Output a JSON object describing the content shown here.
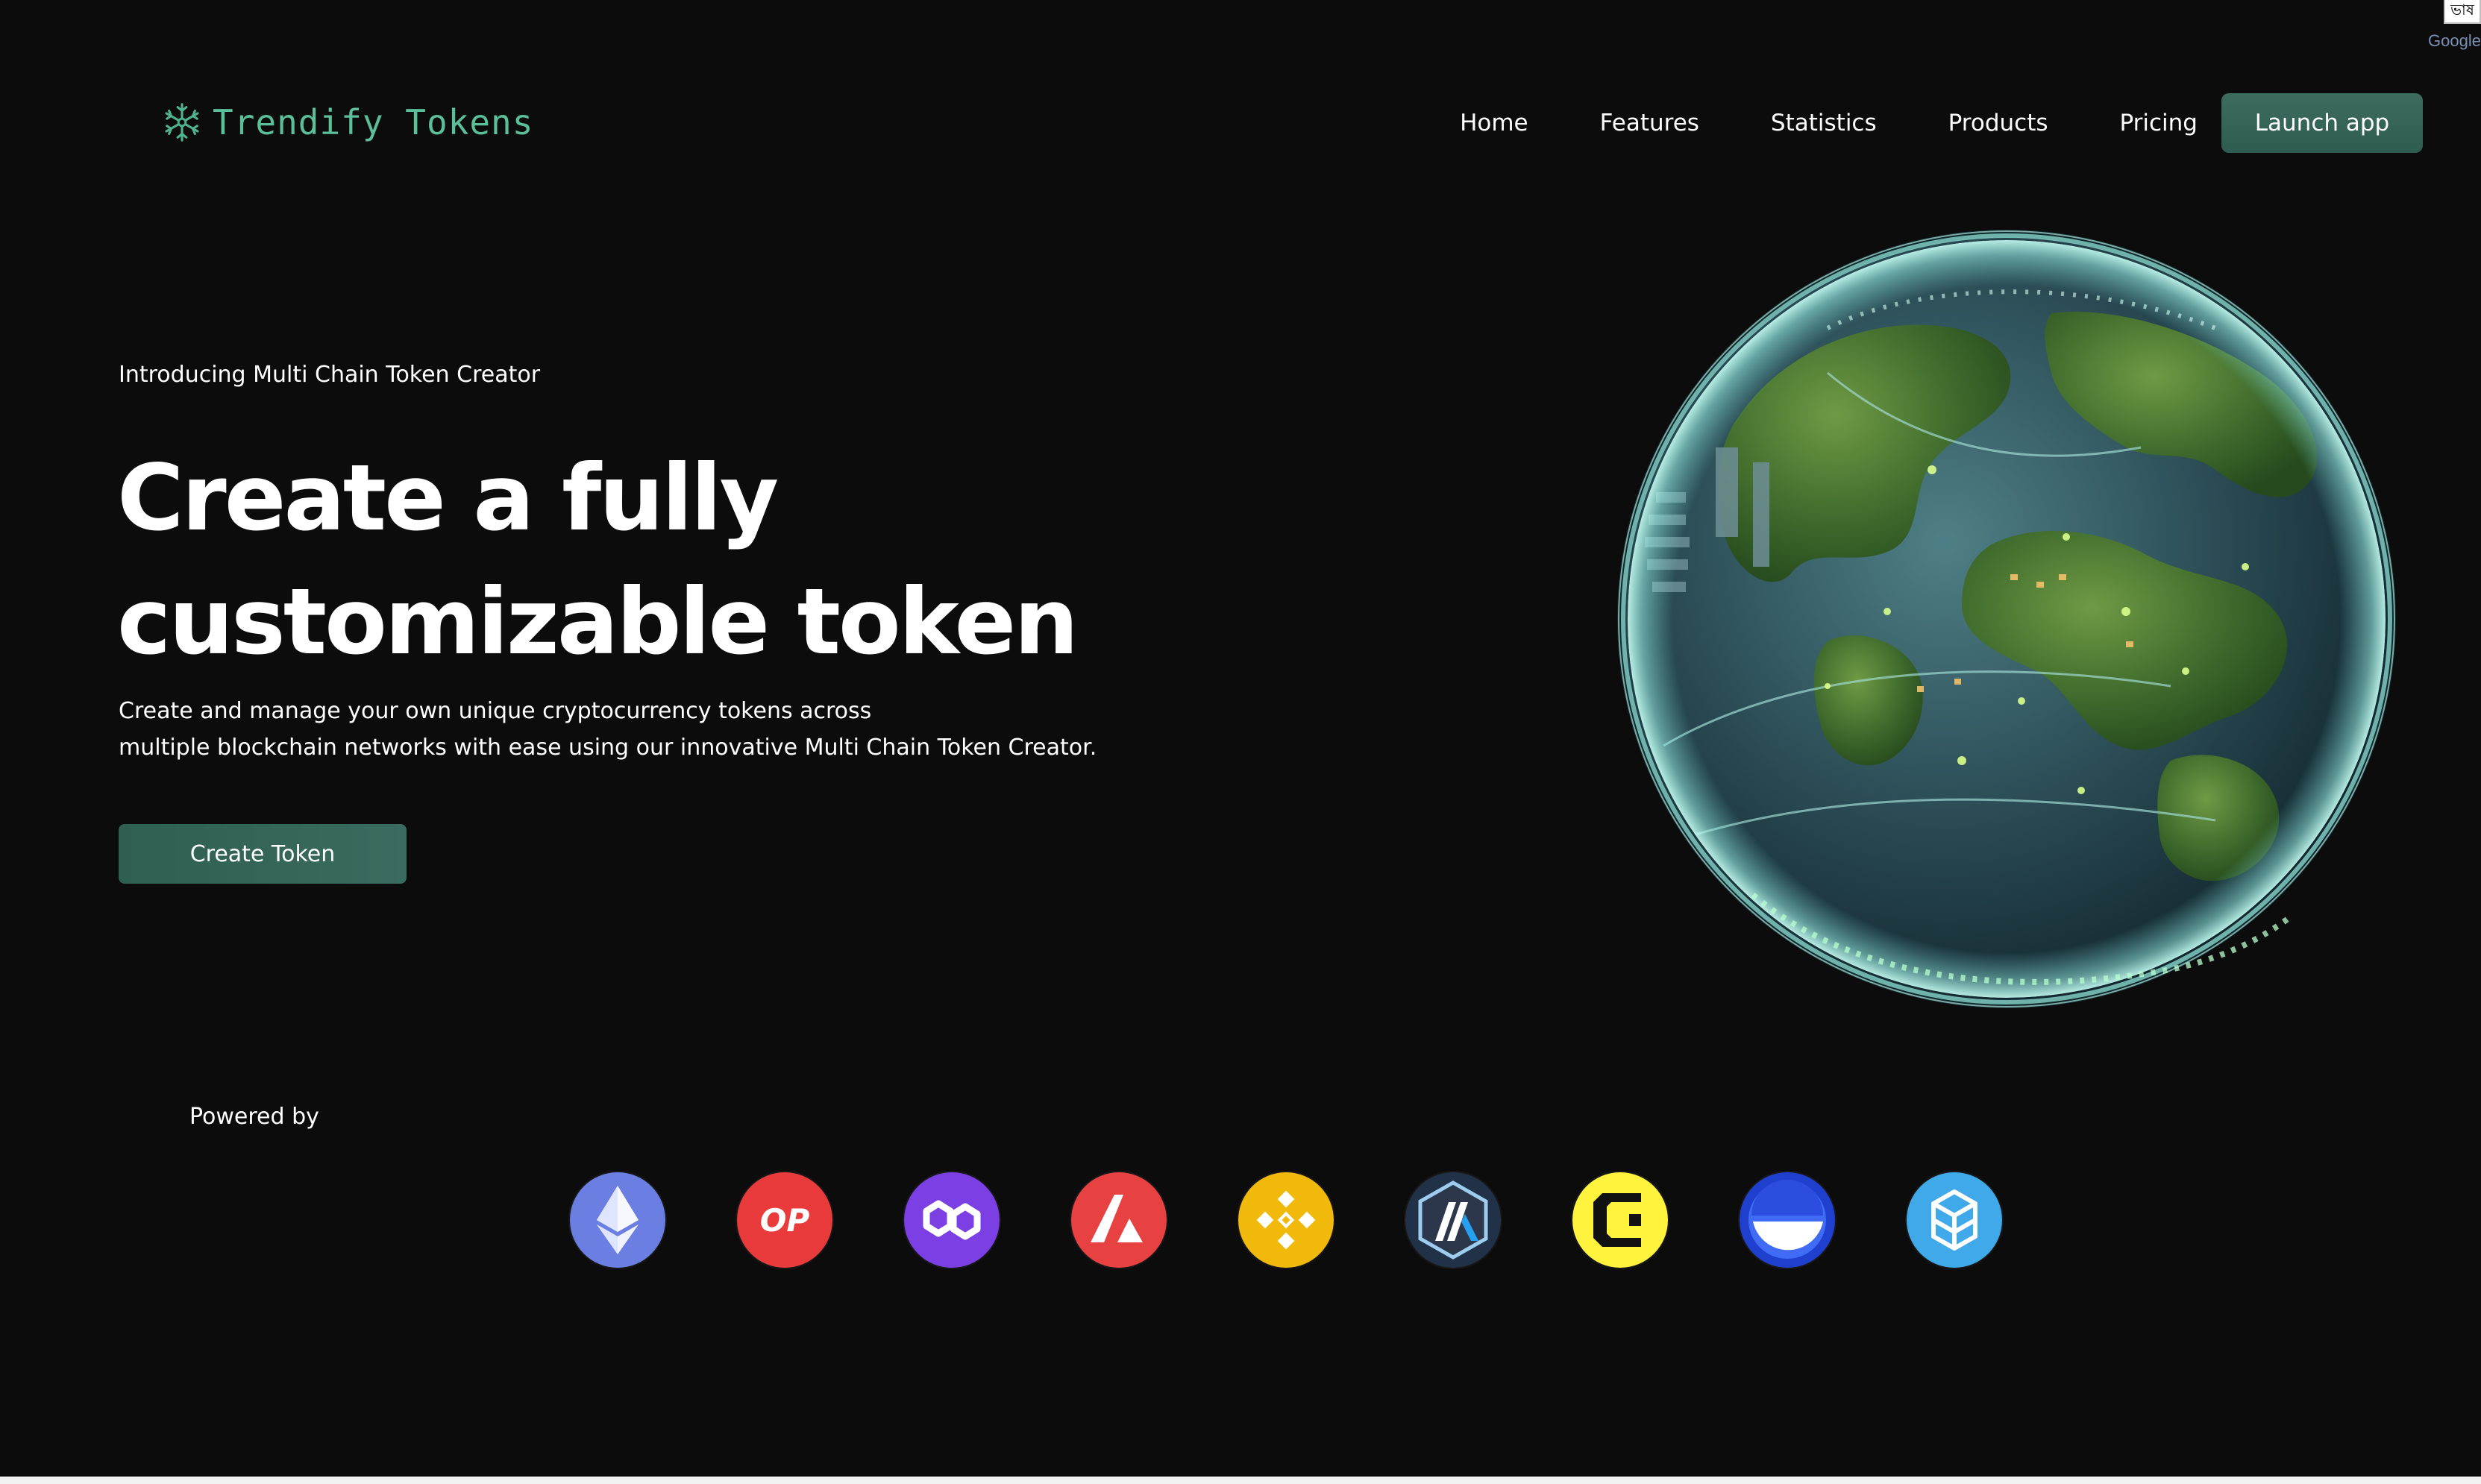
{
  "translate_widget": {
    "glyph": "ভাষ",
    "brand": "Google"
  },
  "header": {
    "logo_text": "Trendify Tokens",
    "nav": [
      {
        "label": "Home"
      },
      {
        "label": "Features"
      },
      {
        "label": "Statistics"
      },
      {
        "label": "Products"
      },
      {
        "label": "Pricing"
      }
    ],
    "launch_label": "Launch app"
  },
  "hero": {
    "eyebrow": "Introducing Multi Chain Token Creator",
    "title_line_1": "Create a fully",
    "title_line_2": "customizable token",
    "subtitle_line_1": "Create and manage your own unique cryptocurrency tokens across",
    "subtitle_line_2": "multiple blockchain networks with ease using our innovative Multi Chain Token Creator.",
    "cta_label": "Create Token"
  },
  "powered": {
    "label": "Powered by",
    "op_text": "OP",
    "chains": [
      {
        "icon": "ethereum-icon",
        "color": "#6b7fe3"
      },
      {
        "icon": "optimism-icon",
        "color": "#e93b3b"
      },
      {
        "icon": "polygon-icon",
        "color": "#7b3fe4"
      },
      {
        "icon": "avalanche-icon",
        "color": "#e84142"
      },
      {
        "icon": "bnb-chain-icon",
        "color": "#f0b90b"
      },
      {
        "icon": "arbitrum-icon",
        "color": "#213147"
      },
      {
        "icon": "core-icon",
        "color": "#fff33d"
      },
      {
        "icon": "base-icon",
        "color": "#2f5be8"
      },
      {
        "icon": "fantom-icon",
        "color": "#3fa9e9"
      }
    ]
  },
  "colors": {
    "background": "#0c0c0d",
    "accent": "#3a6b5f",
    "logo": "#5bbf9a"
  }
}
